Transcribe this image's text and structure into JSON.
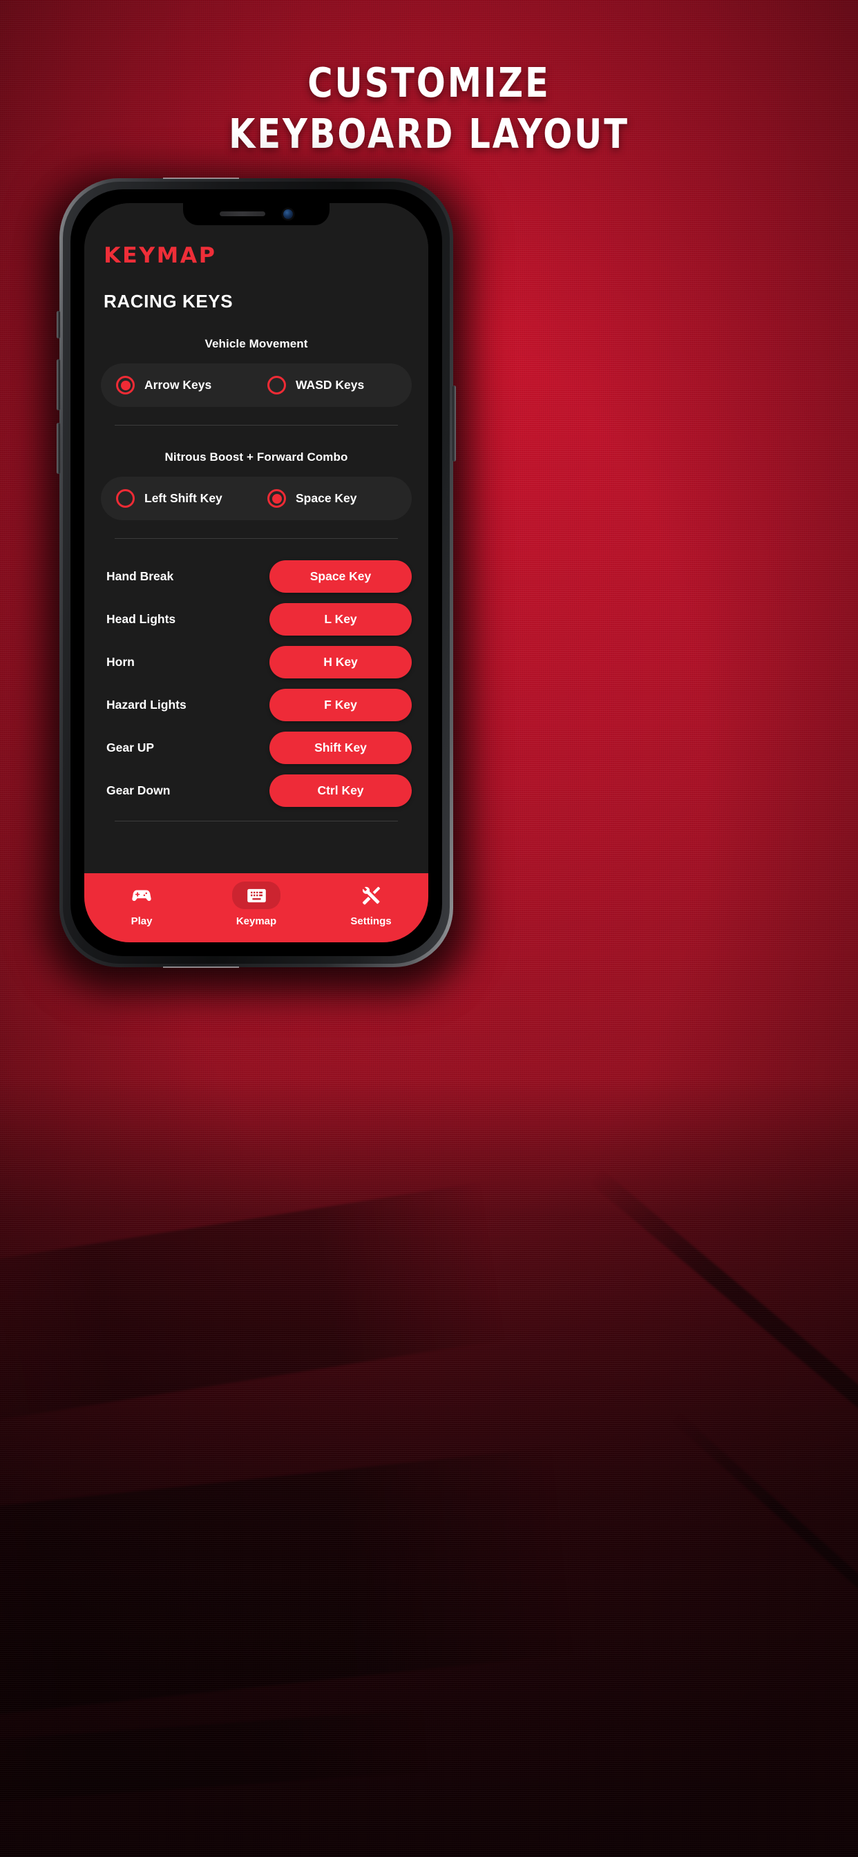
{
  "promo": {
    "headline_line1": "CUSTOMIZE",
    "headline_line2": "KEYBOARD LAYOUT",
    "background_color": "#b01127",
    "accent_color": "#ee2b38"
  },
  "app": {
    "brand": "KEYMAP",
    "page_title": "RACING KEYS",
    "colors": {
      "screen_bg": "#1c1c1c",
      "card_bg": "#262626",
      "accent": "#ee2b38",
      "brand_red": "#ef2e38",
      "divider": "#3c3c3c",
      "text": "#ffffff"
    },
    "groups": [
      {
        "label": "Vehicle Movement",
        "options": [
          {
            "label": "Arrow Keys",
            "selected": true
          },
          {
            "label": "WASD Keys",
            "selected": false
          }
        ]
      },
      {
        "label": "Nitrous Boost + Forward Combo",
        "options": [
          {
            "label": "Left Shift Key",
            "selected": false
          },
          {
            "label": "Space Key",
            "selected": true
          }
        ]
      }
    ],
    "mappings": [
      {
        "action": "Hand Break",
        "key": "Space Key"
      },
      {
        "action": "Head Lights",
        "key": "L Key"
      },
      {
        "action": "Horn",
        "key": "H Key"
      },
      {
        "action": "Hazard Lights",
        "key": "F Key"
      },
      {
        "action": "Gear UP",
        "key": "Shift Key"
      },
      {
        "action": "Gear Down",
        "key": "Ctrl Key"
      }
    ],
    "tabs": [
      {
        "label": "Play",
        "icon": "gamepad-icon",
        "active": false
      },
      {
        "label": "Keymap",
        "icon": "keyboard-icon",
        "active": true
      },
      {
        "label": "Settings",
        "icon": "tools-icon",
        "active": false
      }
    ]
  }
}
